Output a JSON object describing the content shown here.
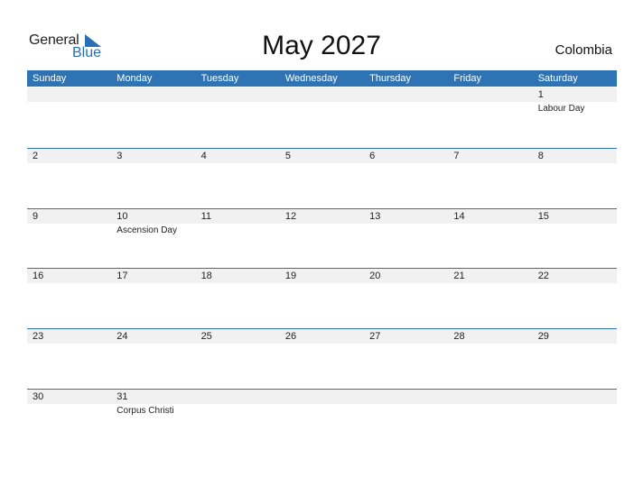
{
  "logo": {
    "general": "General",
    "blue": "Blue",
    "accent_color": "#2a6fb5"
  },
  "title": "May 2027",
  "country": "Colombia",
  "header_color": "#2e74b5",
  "days": [
    "Sunday",
    "Monday",
    "Tuesday",
    "Wednesday",
    "Thursday",
    "Friday",
    "Saturday"
  ],
  "weeks": [
    [
      {
        "d": ""
      },
      {
        "d": ""
      },
      {
        "d": ""
      },
      {
        "d": ""
      },
      {
        "d": ""
      },
      {
        "d": ""
      },
      {
        "d": "1",
        "h": "Labour Day"
      }
    ],
    [
      {
        "d": "2"
      },
      {
        "d": "3"
      },
      {
        "d": "4"
      },
      {
        "d": "5"
      },
      {
        "d": "6"
      },
      {
        "d": "7"
      },
      {
        "d": "8"
      }
    ],
    [
      {
        "d": "9"
      },
      {
        "d": "10",
        "h": "Ascension Day"
      },
      {
        "d": "11"
      },
      {
        "d": "12"
      },
      {
        "d": "13"
      },
      {
        "d": "14"
      },
      {
        "d": "15"
      }
    ],
    [
      {
        "d": "16"
      },
      {
        "d": "17"
      },
      {
        "d": "18"
      },
      {
        "d": "19"
      },
      {
        "d": "20"
      },
      {
        "d": "21"
      },
      {
        "d": "22"
      }
    ],
    [
      {
        "d": "23"
      },
      {
        "d": "24"
      },
      {
        "d": "25"
      },
      {
        "d": "26"
      },
      {
        "d": "27"
      },
      {
        "d": "28"
      },
      {
        "d": "29"
      }
    ],
    [
      {
        "d": "30"
      },
      {
        "d": "31",
        "h": "Corpus Christi"
      },
      {
        "d": ""
      },
      {
        "d": ""
      },
      {
        "d": ""
      },
      {
        "d": ""
      },
      {
        "d": ""
      }
    ]
  ]
}
